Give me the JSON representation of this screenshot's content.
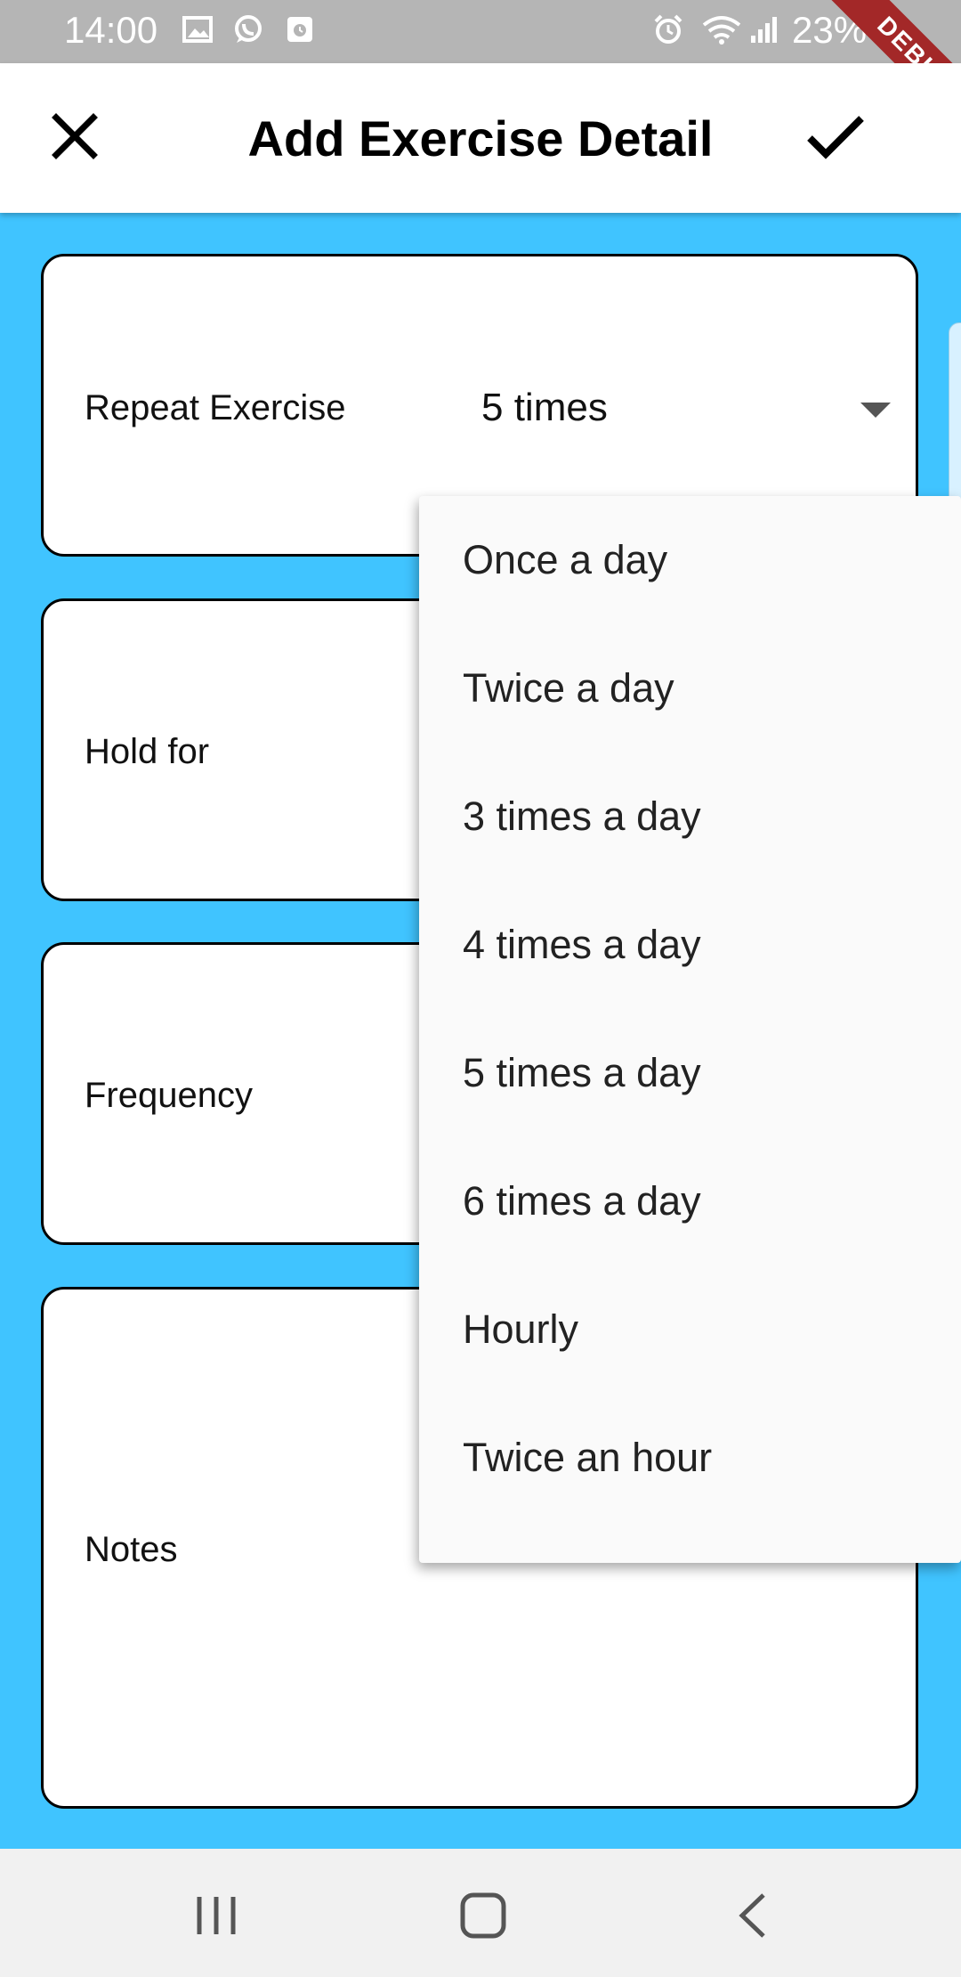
{
  "status_bar": {
    "time": "14:00",
    "battery": "23%",
    "icons": [
      "image-icon",
      "whatsapp-icon",
      "calendar-icon",
      "alarm-icon",
      "wifi-icon",
      "signal-icon",
      "battery-icon"
    ]
  },
  "debug_banner": "DEBUG",
  "app_bar": {
    "title": "Add Exercise Detail",
    "close_icon": "close-icon",
    "save_icon": "check-icon"
  },
  "cards": {
    "repeat": {
      "label": "Repeat Exercise",
      "value": "5 times"
    },
    "hold": {
      "label": "Hold for"
    },
    "frequency": {
      "label": "Frequency"
    },
    "notes": {
      "label": "Notes"
    }
  },
  "menu": {
    "items": [
      "Once a day",
      "Twice a day",
      "3 times a day",
      "4 times a day",
      "5 times a day",
      "6 times a day",
      "Hourly",
      "Twice an hour"
    ]
  },
  "nav_bar": {
    "icons": [
      "recent-apps-icon",
      "home-icon",
      "back-icon"
    ]
  },
  "colors": {
    "background": "#40C4FF",
    "status_bar": "#B5B5B5",
    "debug_banner": "#A32828",
    "menu": "#FAFAFA"
  }
}
